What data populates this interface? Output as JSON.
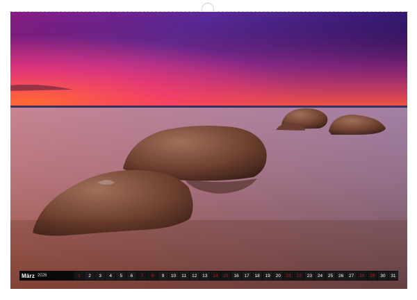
{
  "calendar": {
    "month": "März",
    "year": "2026",
    "days": [
      {
        "n": "1",
        "weekend": true
      },
      {
        "n": "2",
        "weekend": false
      },
      {
        "n": "3",
        "weekend": false
      },
      {
        "n": "4",
        "weekend": false
      },
      {
        "n": "5",
        "weekend": false
      },
      {
        "n": "6",
        "weekend": false
      },
      {
        "n": "7",
        "weekend": true
      },
      {
        "n": "8",
        "weekend": true
      },
      {
        "n": "9",
        "weekend": false
      },
      {
        "n": "10",
        "weekend": false
      },
      {
        "n": "11",
        "weekend": false
      },
      {
        "n": "12",
        "weekend": false
      },
      {
        "n": "13",
        "weekend": false
      },
      {
        "n": "14",
        "weekend": true
      },
      {
        "n": "15",
        "weekend": true
      },
      {
        "n": "16",
        "weekend": false
      },
      {
        "n": "17",
        "weekend": false
      },
      {
        "n": "18",
        "weekend": false
      },
      {
        "n": "19",
        "weekend": false
      },
      {
        "n": "20",
        "weekend": false
      },
      {
        "n": "21",
        "weekend": true
      },
      {
        "n": "22",
        "weekend": true
      },
      {
        "n": "23",
        "weekend": false
      },
      {
        "n": "24",
        "weekend": false
      },
      {
        "n": "25",
        "weekend": false
      },
      {
        "n": "26",
        "weekend": false
      },
      {
        "n": "27",
        "weekend": false
      },
      {
        "n": "28",
        "weekend": true
      },
      {
        "n": "29",
        "weekend": true
      },
      {
        "n": "30",
        "weekend": false
      },
      {
        "n": "31",
        "weekend": false
      }
    ]
  },
  "colors": {
    "sky_top": "#3a1a7a",
    "sky_mid": "#7a3fb8",
    "horizon_glow": "#ff5a3c",
    "water": "#a97a86",
    "water_near": "#6a4030",
    "rock": "#7b4a35",
    "weekend_text": "#b0211a"
  }
}
